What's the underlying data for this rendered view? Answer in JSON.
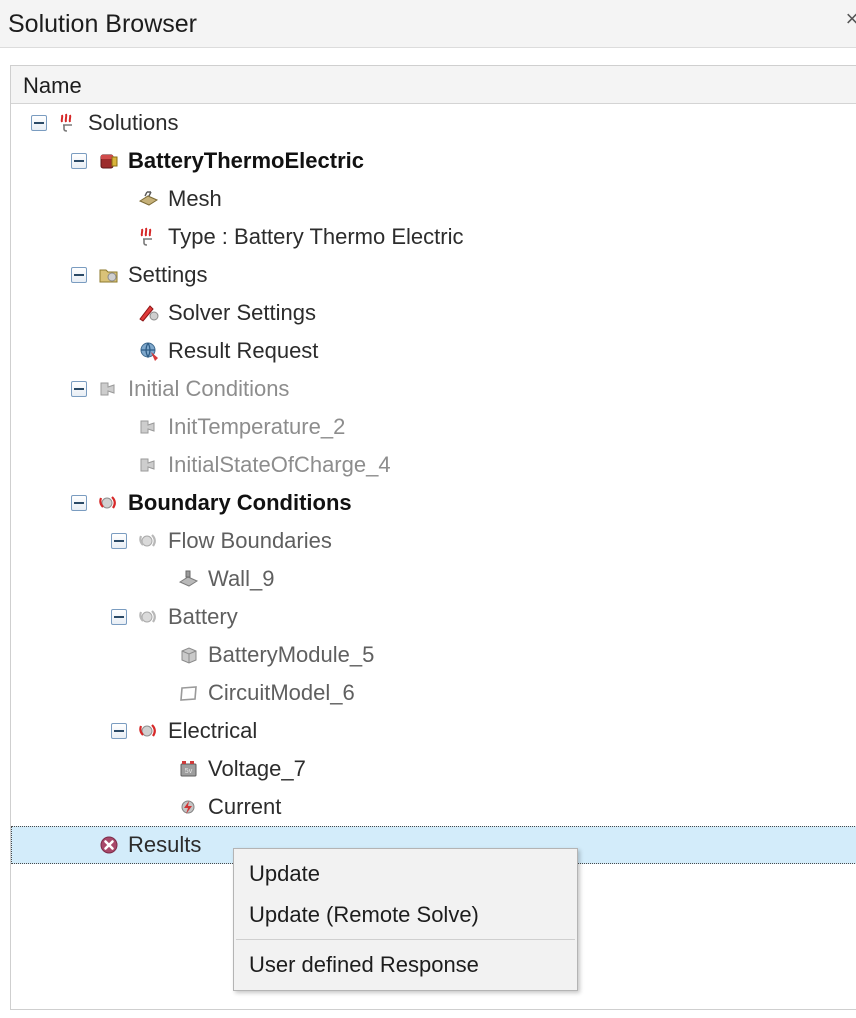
{
  "window": {
    "title": "Solution Browser",
    "close_label": "×"
  },
  "tree": {
    "column_header": "Name",
    "rows": [
      {
        "label": "Solutions",
        "icon": "thermal-flame-icon",
        "indent": 0,
        "expander": "collapse",
        "style": "normal"
      },
      {
        "label": "BatteryThermoElectric",
        "icon": "battery-icon",
        "indent": 1,
        "expander": "collapse",
        "style": "bold"
      },
      {
        "label": "Mesh",
        "icon": "mesh-icon",
        "indent": 2,
        "expander": "none",
        "style": "normal"
      },
      {
        "label": "Type : Battery Thermo Electric",
        "icon": "thermal-flame-icon",
        "indent": 2,
        "expander": "none",
        "style": "normal"
      },
      {
        "label": "Settings",
        "icon": "folder-settings-icon",
        "indent": 1,
        "expander": "collapse",
        "style": "normal"
      },
      {
        "label": "Solver Settings",
        "icon": "solver-pen-icon",
        "indent": 2,
        "expander": "none",
        "style": "normal"
      },
      {
        "label": "Result Request",
        "icon": "result-request-icon",
        "indent": 2,
        "expander": "none",
        "style": "normal"
      },
      {
        "label": "Initial Conditions",
        "icon": "initial-condition-icon",
        "indent": 1,
        "expander": "collapse",
        "style": "dim"
      },
      {
        "label": "InitTemperature_2",
        "icon": "initial-condition-icon",
        "indent": 2,
        "expander": "none",
        "style": "dim"
      },
      {
        "label": "InitialStateOfCharge_4",
        "icon": "initial-condition-icon",
        "indent": 2,
        "expander": "none",
        "style": "dim"
      },
      {
        "label": "Boundary Conditions",
        "icon": "boundary-condition-icon",
        "indent": 1,
        "expander": "collapse",
        "style": "bold"
      },
      {
        "label": "Flow Boundaries",
        "icon": "boundary-gray-icon",
        "indent": 2,
        "expander": "collapse",
        "style": "mid"
      },
      {
        "label": "Wall_9",
        "icon": "wall-icon",
        "indent": 3,
        "expander": "none",
        "style": "mid"
      },
      {
        "label": "Battery",
        "icon": "boundary-gray-icon",
        "indent": 2,
        "expander": "collapse",
        "style": "mid"
      },
      {
        "label": "BatteryModule_5",
        "icon": "module-cube-icon",
        "indent": 3,
        "expander": "none",
        "style": "mid"
      },
      {
        "label": "CircuitModel_6",
        "icon": "circuit-outline-icon",
        "indent": 3,
        "expander": "none",
        "style": "mid"
      },
      {
        "label": "Electrical",
        "icon": "boundary-condition-icon",
        "indent": 2,
        "expander": "collapse",
        "style": "normal"
      },
      {
        "label": "Voltage_7",
        "icon": "voltage-battery-icon",
        "indent": 3,
        "expander": "none",
        "style": "normal"
      },
      {
        "label": "Current",
        "icon": "current-icon",
        "indent": 3,
        "expander": "none",
        "style": "normal"
      },
      {
        "label": "Results",
        "icon": "results-error-icon",
        "indent": 1,
        "expander": "none",
        "style": "normal",
        "selected": true
      }
    ]
  },
  "context_menu": {
    "items": [
      {
        "label": "Update",
        "type": "item"
      },
      {
        "label": "Update (Remote Solve)",
        "type": "item"
      },
      {
        "label": "",
        "type": "separator"
      },
      {
        "label": "User defined Response",
        "type": "item"
      }
    ]
  },
  "colors": {
    "selection": "#d3ecfa",
    "panel_border": "#cfcfcf",
    "header_bg": "#f4f4f4",
    "menu_bg": "#f2f2f2",
    "accent_red": "#c62828"
  }
}
